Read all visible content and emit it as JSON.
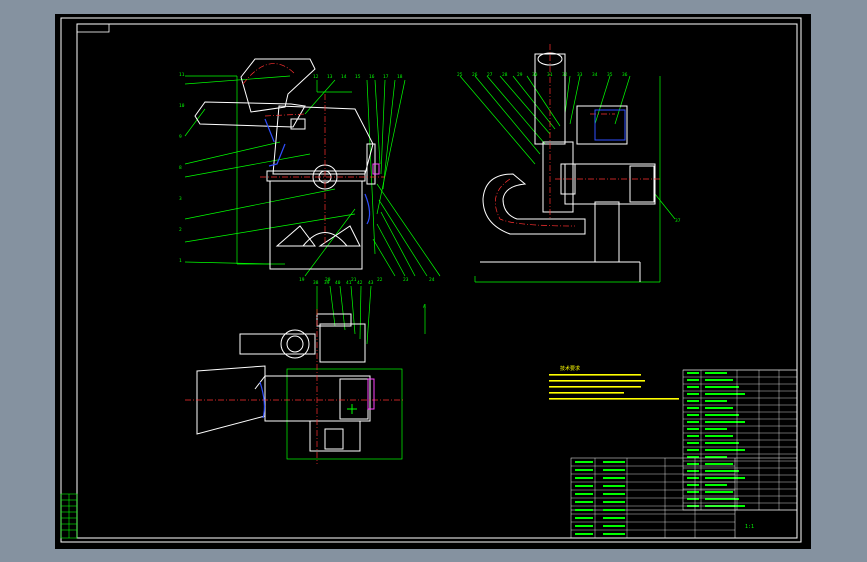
{
  "drawing": {
    "background_color": "#000000",
    "window_color": "#8592a0",
    "colors": {
      "outline": "#ffffff",
      "leader": "#00ff00",
      "centerline": "#ff3030",
      "hidden": "#3050ff",
      "magenta": "#ff40ff",
      "note": "#ffff00",
      "annotation": "#00ff00",
      "grid": "#ffffff"
    }
  },
  "technical_requirements": {
    "title": "技术要求"
  },
  "side_view_labels": {
    "left": [
      "11",
      "10",
      "9",
      "8",
      "3",
      "2",
      "1"
    ],
    "top": [
      "12",
      "13",
      "14",
      "15",
      "16",
      "17",
      "18"
    ],
    "bottom": [
      "19",
      "20",
      "21",
      "22",
      "23",
      "24"
    ]
  },
  "end_view_labels": {
    "top": [
      "25",
      "26",
      "27",
      "28",
      "29",
      "30",
      "31",
      "32",
      "33",
      "34",
      "35",
      "36"
    ],
    "right": [
      "37"
    ]
  },
  "plan_view_labels": {
    "top": [
      "38",
      "39",
      "40",
      "41",
      "42",
      "43"
    ]
  },
  "section_label": "A",
  "title_block": {
    "scale_note": "1:1"
  },
  "left_strip": {
    "rows": 7
  }
}
